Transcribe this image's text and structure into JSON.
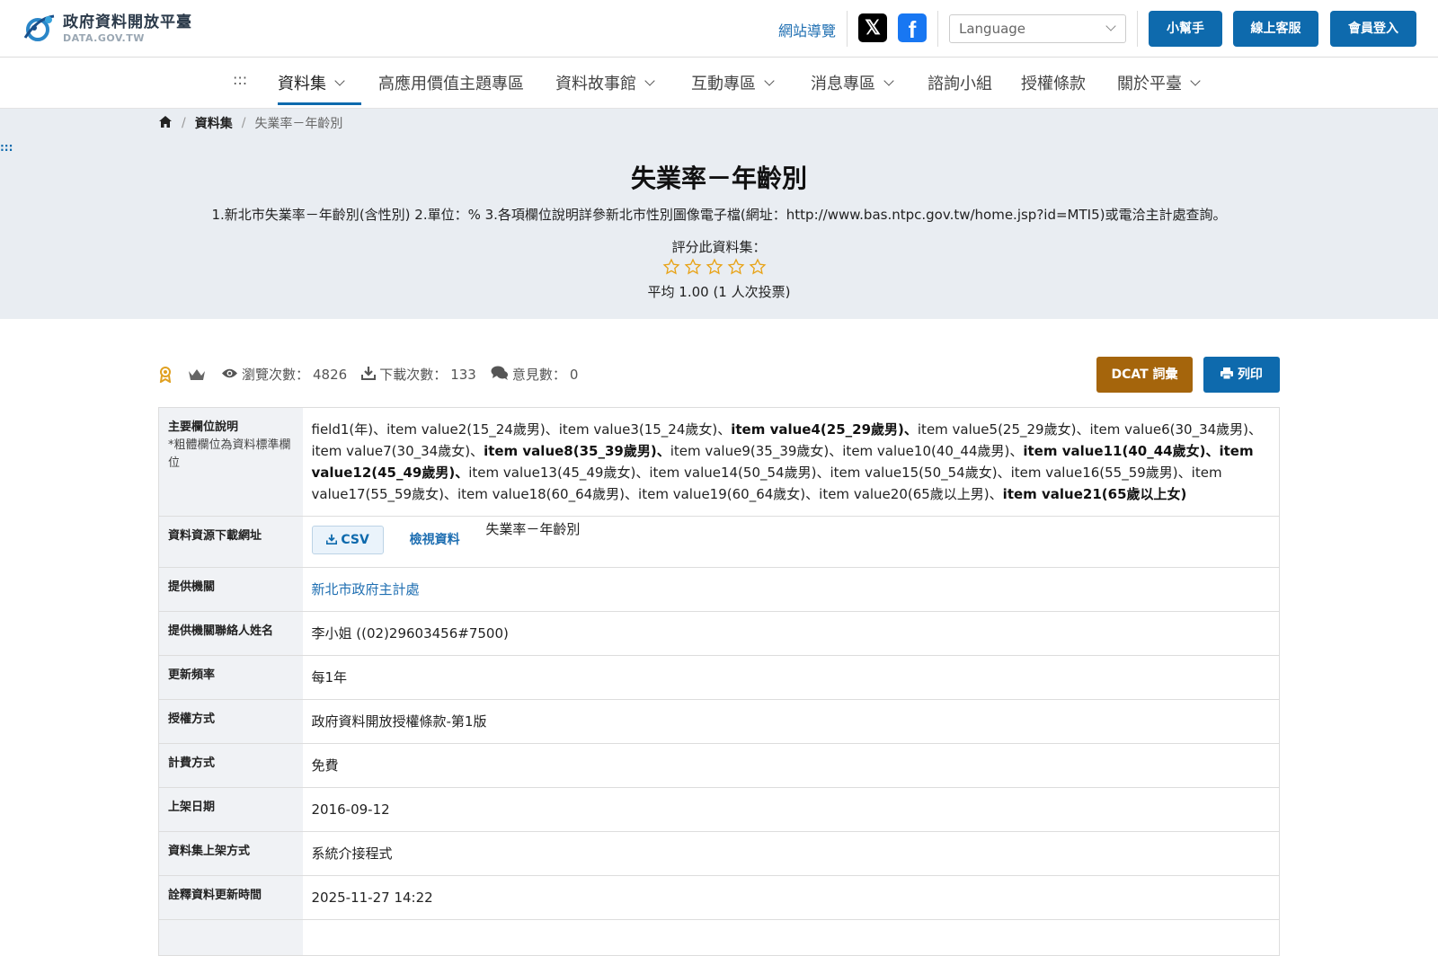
{
  "header": {
    "logo_title": "政府資料開放平臺",
    "logo_sub": "DATA.GOV.TW",
    "sitemap_label": "網站導覽",
    "x_icon": "x-icon",
    "fb_icon": "facebook-icon",
    "language_placeholder": "Language",
    "helper_label": "小幫手",
    "support_label": "線上客服",
    "login_label": "會員登入",
    "accent_color": "#0e6aad"
  },
  "nav": {
    "skip_label": ":::",
    "items": [
      {
        "label": "資料集",
        "dropdown": true,
        "active": true
      },
      {
        "label": "高應用價值主題專區",
        "dropdown": false
      },
      {
        "label": "資料故事館",
        "dropdown": true
      },
      {
        "label": "互動專區",
        "dropdown": true
      },
      {
        "label": "消息專區",
        "dropdown": true
      },
      {
        "label": "諮詢小組",
        "dropdown": false
      },
      {
        "label": "授權條款",
        "dropdown": false
      },
      {
        "label": "關於平臺",
        "dropdown": true
      }
    ]
  },
  "breadcrumb": {
    "home_icon": "home-icon",
    "level1": "資料集",
    "current": "失業率－年齡別"
  },
  "hero": {
    "skip_label": ":::",
    "title": "失業率－年齡別",
    "description": "1.新北市失業率－年齡別(含性別) 2.單位：% 3.各項欄位說明詳參新北市性別圖像電子檔(網址：http://www.bas.ntpc.gov.tw/home.jsp?id=MTI5)或電洽主計處查詢。",
    "rate_label": "評分此資料集：",
    "stars_total": 5,
    "rating_text": "平均 1.00 (1 人次投票)"
  },
  "stats": {
    "views_label": "瀏覽次數：",
    "views": "4826",
    "downloads_label": "下載次數：",
    "downloads": "133",
    "comments_label": "意見數：",
    "comments": "0"
  },
  "actions": {
    "dcat_label": "DCAT 詞彙",
    "print_label": "列印",
    "dcat_color": "#a5650c"
  },
  "table": {
    "fields_header": "主要欄位說明",
    "fields_note": "*粗體欄位為資料標準欄位",
    "fields": [
      {
        "text": "field1(年)",
        "bold": false
      },
      {
        "text": "item value2(15_24歲男)",
        "bold": false
      },
      {
        "text": "item value3(15_24歲女)",
        "bold": false
      },
      {
        "text": "item value4(25_29歲男)",
        "bold": true
      },
      {
        "text": "item value5(25_29歲女)",
        "bold": false
      },
      {
        "text": "item value6(30_34歲男)",
        "bold": false
      },
      {
        "text": "item value7(30_34歲女)",
        "bold": false
      },
      {
        "text": "item value8(35_39歲男)",
        "bold": true
      },
      {
        "text": "item value9(35_39歲女)",
        "bold": false
      },
      {
        "text": "item value10(40_44歲男)",
        "bold": false
      },
      {
        "text": "item value11(40_44歲女)",
        "bold": true
      },
      {
        "text": "item value12(45_49歲男)",
        "bold": true
      },
      {
        "text": "item value13(45_49歲女)",
        "bold": false
      },
      {
        "text": "item value14(50_54歲男)",
        "bold": false
      },
      {
        "text": "item value15(50_54歲女)",
        "bold": false
      },
      {
        "text": "item value16(55_59歲男)",
        "bold": false
      },
      {
        "text": "item value17(55_59歲女)",
        "bold": false
      },
      {
        "text": "item value18(60_64歲男)",
        "bold": false
      },
      {
        "text": "item value19(60_64歲女)",
        "bold": false
      },
      {
        "text": "item value20(65歲以上男)",
        "bold": false
      },
      {
        "text": "item value21(65歲以上女)",
        "bold": true
      }
    ],
    "download_header": "資料資源下載網址",
    "csv_label": "CSV",
    "view_label": "檢視資料",
    "resource_name": "失業率－年齡別",
    "rows": [
      {
        "key": "提供機關",
        "value": "新北市政府主計處",
        "link": true
      },
      {
        "key": "提供機關聯絡人姓名",
        "value": "李小姐 ((02)29603456#7500)",
        "link": false
      },
      {
        "key": "更新頻率",
        "value": "每1年",
        "link": false
      },
      {
        "key": "授權方式",
        "value": "政府資料開放授權條款-第1版",
        "link": false
      },
      {
        "key": "計費方式",
        "value": "免費",
        "link": false
      },
      {
        "key": "上架日期",
        "value": "2016-09-12",
        "link": false
      },
      {
        "key": "資料集上架方式",
        "value": "系統介接程式",
        "link": false
      },
      {
        "key": "詮釋資料更新時間",
        "value": "2025-11-27 14:22",
        "link": false
      }
    ]
  }
}
